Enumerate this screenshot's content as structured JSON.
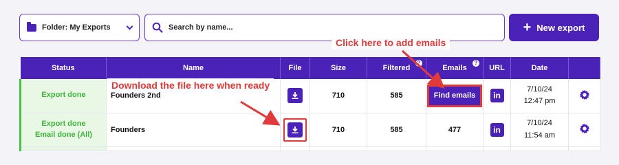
{
  "toolbar": {
    "folder_label": "Folder: My Exports",
    "search_placeholder": "Search by name...",
    "new_export_label": "New export"
  },
  "annotations": {
    "add_emails": "Click here to add emails",
    "download_file": "Download the file here when ready"
  },
  "table": {
    "headers": {
      "status": "Status",
      "name": "Name",
      "file": "File",
      "size": "Size",
      "filtered": "Filtered",
      "emails": "Emails",
      "url": "URL",
      "date": "Date"
    },
    "rows": [
      {
        "status_line1": "Export done",
        "status_line2": "",
        "name": "Founders 2nd",
        "size": "710",
        "filtered": "585",
        "emails": "Find emails",
        "date_line1": "7/10/24",
        "date_line2": "12:47 pm"
      },
      {
        "status_line1": "Export done",
        "status_line2": "Email done (All)",
        "name": "Founders",
        "size": "710",
        "filtered": "585",
        "emails": "477",
        "date_line1": "7/10/24",
        "date_line2": "11:54 am"
      }
    ]
  },
  "colors": {
    "brand": "#4a22b8",
    "annotation": "#e03a3a",
    "status_done": "#3bb53b"
  },
  "icons": [
    "folder-icon",
    "chevron-down-icon",
    "search-icon",
    "plus-icon",
    "download-icon",
    "linkedin-icon",
    "gear-icon",
    "help-icon"
  ]
}
